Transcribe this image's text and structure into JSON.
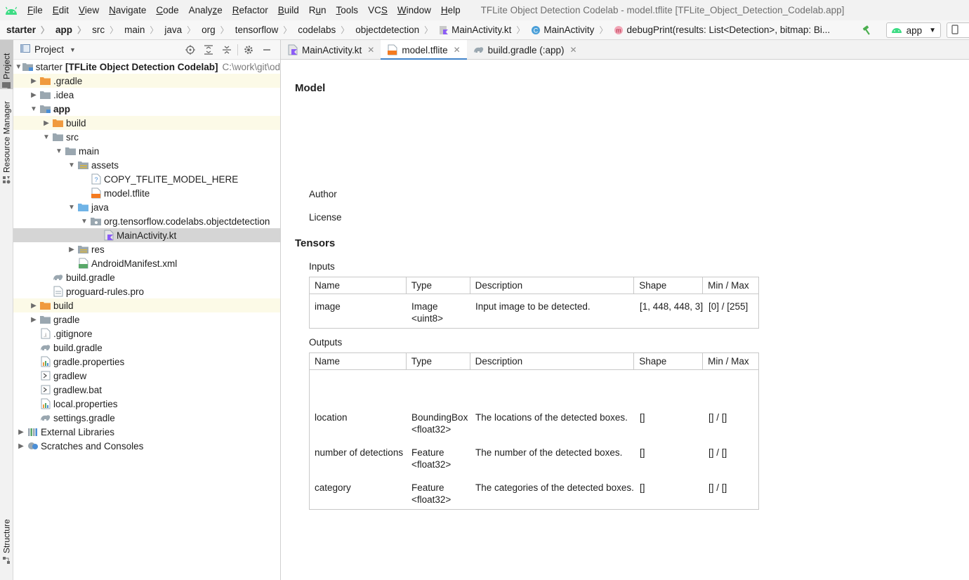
{
  "menubar": {
    "items": [
      "File",
      "Edit",
      "View",
      "Navigate",
      "Code",
      "Analyze",
      "Refactor",
      "Build",
      "Run",
      "Tools",
      "VCS",
      "Window",
      "Help"
    ],
    "mnemonics": [
      "F",
      "E",
      "V",
      "N",
      "C",
      "z",
      "R",
      "B",
      "u",
      "T",
      "S",
      "W",
      "H"
    ],
    "title": "TFLite Object Detection Codelab - model.tflite [TFLite_Object_Detection_Codelab.app]"
  },
  "navbar": {
    "crumbs": [
      "starter",
      "app",
      "src",
      "main",
      "java",
      "org",
      "tensorflow",
      "codelabs",
      "objectdetection",
      "MainActivity.kt",
      "MainActivity",
      "debugPrint(results: List<Detection>, bitmap: Bi..."
    ],
    "run_config": "app"
  },
  "stripe": {
    "project_tab": "Project",
    "resource_tab": "Resource Manager",
    "structure_tab": "Structure"
  },
  "project_panel": {
    "title": "Project",
    "tree": [
      {
        "label": "starter",
        "extra": "[TFLite Object Detection Codelab]",
        "path": "C:\\work\\git\\od",
        "icon": "module-folder-icon"
      },
      {
        "label": ".gradle",
        "icon": "orange-folder-icon"
      },
      {
        "label": ".idea",
        "icon": "grey-folder-icon"
      },
      {
        "label": "app",
        "icon": "module-folder-icon"
      },
      {
        "label": "build",
        "icon": "orange-folder-icon"
      },
      {
        "label": "src",
        "icon": "grey-folder-icon"
      },
      {
        "label": "main",
        "icon": "grey-folder-icon"
      },
      {
        "label": "assets",
        "icon": "assets-folder-icon"
      },
      {
        "label": "COPY_TFLITE_MODEL_HERE",
        "icon": "unknown-file-icon"
      },
      {
        "label": "model.tflite",
        "icon": "tflite-file-icon"
      },
      {
        "label": "java",
        "icon": "blue-folder-icon"
      },
      {
        "label": "org.tensorflow.codelabs.objectdetection",
        "icon": "package-icon"
      },
      {
        "label": "MainActivity.kt",
        "icon": "kotlin-file-icon"
      },
      {
        "label": "res",
        "icon": "res-folder-icon"
      },
      {
        "label": "AndroidManifest.xml",
        "icon": "manifest-file-icon"
      },
      {
        "label": "build.gradle",
        "icon": "gradle-file-icon"
      },
      {
        "label": "proguard-rules.pro",
        "icon": "text-file-icon"
      },
      {
        "label": "build",
        "icon": "orange-folder-icon"
      },
      {
        "label": "gradle",
        "icon": "grey-folder-icon"
      },
      {
        "label": ".gitignore",
        "icon": "gitignore-file-icon"
      },
      {
        "label": "build.gradle",
        "icon": "gradle-file-icon"
      },
      {
        "label": "gradle.properties",
        "icon": "properties-file-icon"
      },
      {
        "label": "gradlew",
        "icon": "script-file-icon"
      },
      {
        "label": "gradlew.bat",
        "icon": "script-file-icon"
      },
      {
        "label": "local.properties",
        "icon": "properties-file-icon"
      },
      {
        "label": "settings.gradle",
        "icon": "gradle-file-icon"
      },
      {
        "label": "External Libraries",
        "icon": "libraries-icon"
      },
      {
        "label": "Scratches and Consoles",
        "icon": "scratches-icon"
      }
    ]
  },
  "editor_tabs": [
    {
      "label": "MainActivity.kt",
      "icon": "kotlin-file-icon",
      "active": false
    },
    {
      "label": "model.tflite",
      "icon": "tflite-file-icon",
      "active": true
    },
    {
      "label": "build.gradle (:app)",
      "icon": "gradle-file-icon",
      "active": false
    }
  ],
  "model_view": {
    "model_heading": "Model",
    "author_label": "Author",
    "license_label": "License",
    "tensors_heading": "Tensors",
    "inputs_label": "Inputs",
    "outputs_label": "Outputs",
    "columns": [
      "Name",
      "Type",
      "Description",
      "Shape",
      "Min / Max"
    ],
    "inputs": [
      {
        "name": "image",
        "type": "Image",
        "subtype": "<uint8>",
        "description": "Input image to be detected.",
        "shape": "[1, 448, 448, 3]",
        "minmax": "[0] / [255]"
      }
    ],
    "outputs": [
      {
        "name": "location",
        "type": "BoundingBox",
        "subtype": "<float32>",
        "description": "The locations of the detected boxes.",
        "shape": "[]",
        "minmax": "[] / []"
      },
      {
        "name": "number of detections",
        "type": "Feature",
        "subtype": "<float32>",
        "description": "The number of the detected boxes.",
        "shape": "[]",
        "minmax": "[] / []"
      },
      {
        "name": "category",
        "type": "Feature",
        "subtype": "<float32>",
        "description": "The categories of the detected boxes.",
        "shape": "[]",
        "minmax": "[] / []"
      }
    ]
  }
}
